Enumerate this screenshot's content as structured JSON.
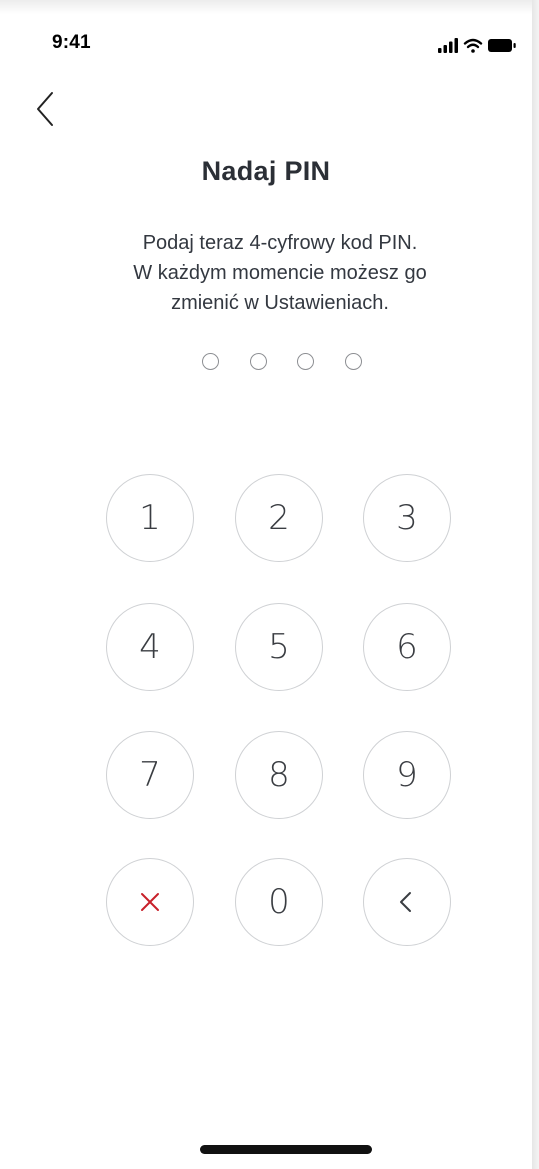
{
  "status_bar": {
    "time": "9:41",
    "icons": [
      "signal-icon",
      "wifi-icon",
      "battery-icon"
    ]
  },
  "nav": {
    "back_icon": "chevron-left-icon"
  },
  "screen": {
    "title": "Nadaj PIN",
    "subtitle_lines": [
      "Podaj teraz 4-cyfrowy kod PIN.",
      "W każdym momencie możesz go",
      "zmienić w Ustawieniach."
    ],
    "pin_length": 4,
    "pin_entered": 0
  },
  "keypad": {
    "keys": [
      "1",
      "2",
      "3",
      "4",
      "5",
      "6",
      "7",
      "8",
      "9",
      "0"
    ],
    "clear_icon": "close-icon",
    "backspace_icon": "chevron-left-icon"
  },
  "colors": {
    "title": "#2b2f36",
    "text": "#333840",
    "key_border": "#cfd1d4",
    "clear_accent": "#c8202a",
    "background": "#ffffff"
  }
}
